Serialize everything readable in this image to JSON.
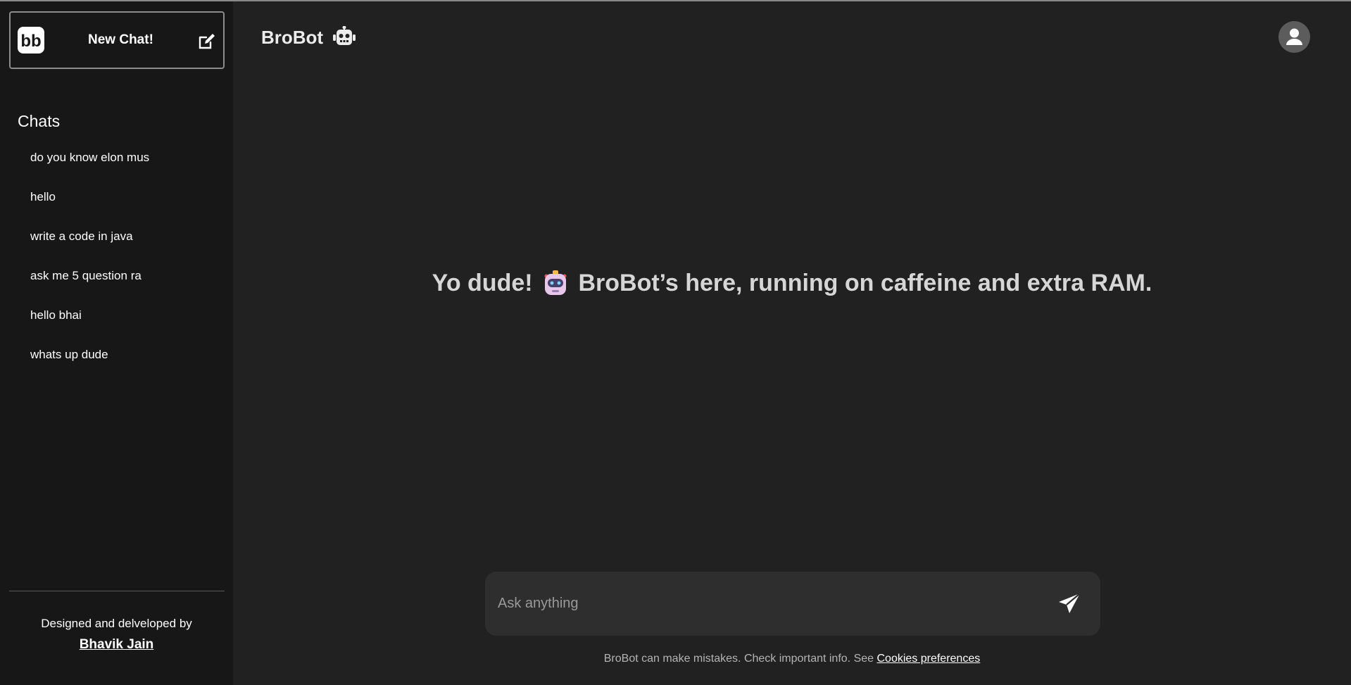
{
  "sidebar": {
    "new_chat_label": "New Chat!",
    "chats_heading": "Chats",
    "chats": [
      "do you know elon mus",
      "hello",
      "write a code in java",
      "ask me 5 question ra",
      "hello bhai",
      "whats up dude"
    ],
    "credit_text": "Designed and delveloped by",
    "author_name": "Bhavik Jain"
  },
  "header": {
    "title": "BroBot",
    "title_icon": "robot-icon",
    "profile_icon": "user-avatar-icon"
  },
  "main": {
    "greeting_before": "Yo dude!",
    "greeting_after": "BroBot’s here, running on caffeine and extra RAM."
  },
  "composer": {
    "placeholder": "Ask anything",
    "value": "",
    "send_icon": "send-icon"
  },
  "footer": {
    "disclaimer": "BroBot can make mistakes. Check important info. See",
    "link_label": "Cookies preferences"
  },
  "colors": {
    "background": "#212121",
    "sidebar": "#171717",
    "input": "#2e2e2e"
  }
}
